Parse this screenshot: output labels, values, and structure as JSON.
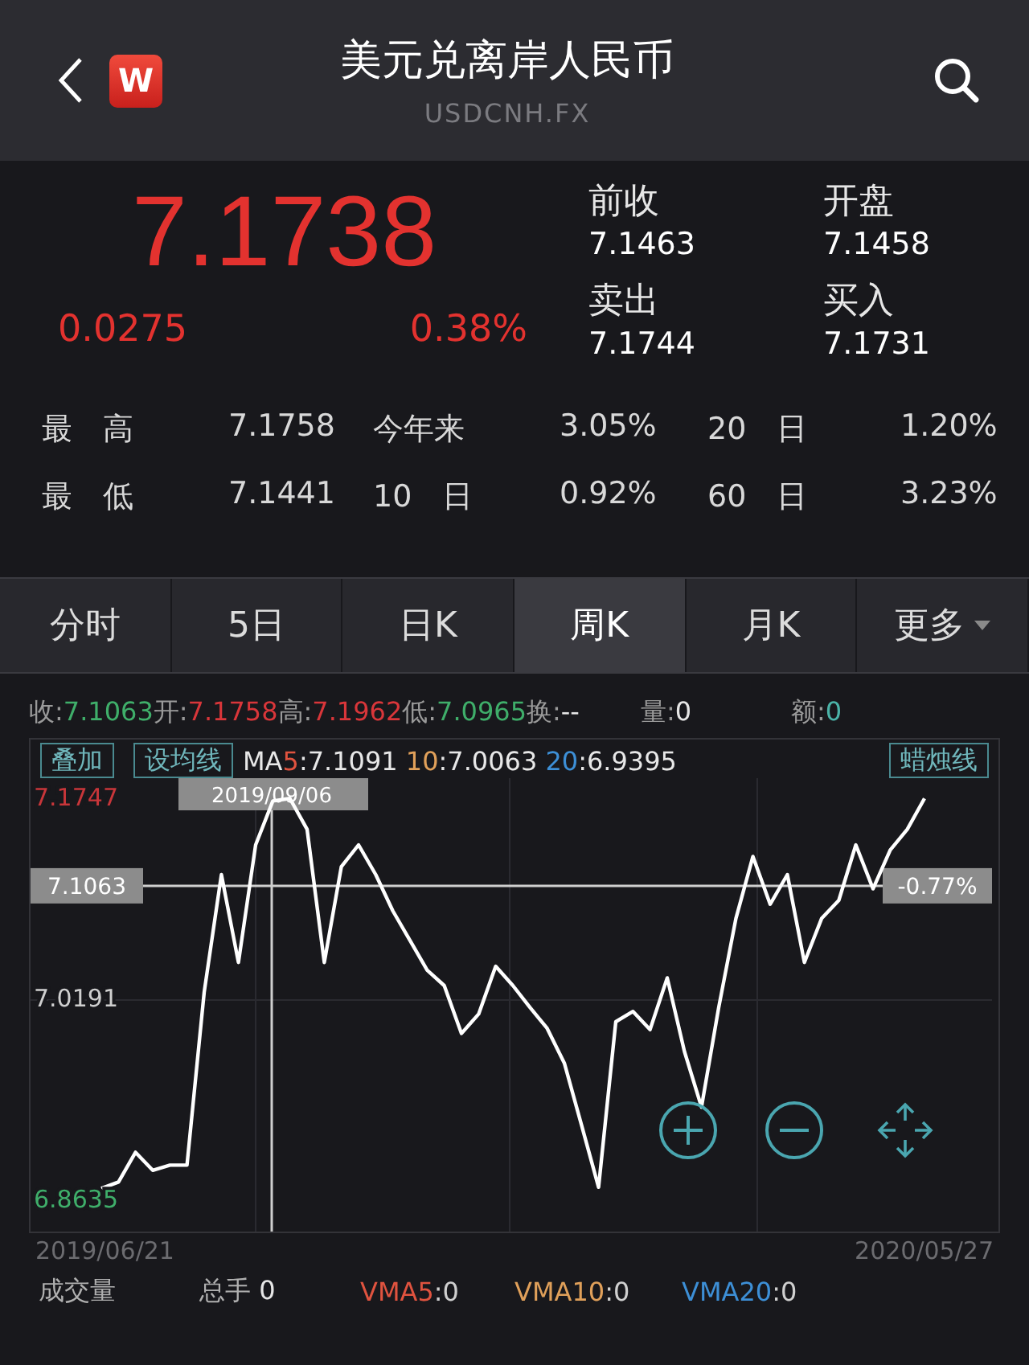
{
  "header": {
    "title": "美元兑离岸人民币",
    "subtitle": "USDCNH.FX",
    "logo": "W"
  },
  "quote": {
    "price": "7.1738",
    "change": "0.0275",
    "change_pct": "0.38%",
    "fields": [
      {
        "label": "前收",
        "value": "7.1463"
      },
      {
        "label": "开盘",
        "value": "7.1458"
      },
      {
        "label": "卖出",
        "value": "7.1744"
      },
      {
        "label": "买入",
        "value": "7.1731"
      }
    ]
  },
  "stats": [
    [
      {
        "label": "最　高",
        "value": "7.1758"
      },
      {
        "label": "今年来",
        "value": "3.05%"
      },
      {
        "label": "20　日",
        "value": "1.20%"
      }
    ],
    [
      {
        "label": "最　低",
        "value": "7.1441"
      },
      {
        "label": "10　日",
        "value": "0.92%"
      },
      {
        "label": "60　日",
        "value": "3.23%"
      }
    ]
  ],
  "tabs": [
    {
      "label": "分时",
      "selected": false
    },
    {
      "label": "5日",
      "selected": false
    },
    {
      "label": "日K",
      "selected": false
    },
    {
      "label": "周K",
      "selected": true
    },
    {
      "label": "月K",
      "selected": false
    },
    {
      "label": "更多",
      "selected": false,
      "dropdown": true
    }
  ],
  "info": [
    {
      "label": "收:",
      "value": "7.1063",
      "color": "#3fae6a"
    },
    {
      "label": "开:",
      "value": "7.1758",
      "color": "#d9363a"
    },
    {
      "label": "高:",
      "value": "7.1962",
      "color": "#d9363a"
    },
    {
      "label": "低:",
      "value": "7.0965",
      "color": "#3fae6a"
    },
    {
      "label": "换:",
      "value": "--",
      "color": "#e6e6e6"
    },
    {
      "label": "量:",
      "value": "0",
      "color": "#e6e6e6"
    },
    {
      "label": "额:",
      "value": "0",
      "color": "#4bb3a8"
    }
  ],
  "chart_tools": {
    "overlay": "叠加",
    "ma_setting": "设均线",
    "style": "蜡烛线",
    "ma_prefix": "MA",
    "ma": [
      {
        "period": "5",
        "value": ":7.1091",
        "color": "#e0533f"
      },
      {
        "period": "10",
        "value": ":7.0063",
        "color": "#e0a05a"
      },
      {
        "period": "20",
        "value": ":6.9395",
        "color": "#3d8fd6"
      }
    ]
  },
  "chart": {
    "chart_data": {
      "type": "line",
      "ylim": [
        6.8635,
        7.1747
      ],
      "yticks": [
        7.1747,
        7.0191,
        6.8635
      ],
      "grid": true,
      "ref_lines": [
        {
          "axis": "y",
          "value": 7.1063,
          "label": "7.1063"
        }
      ],
      "series": [
        {
          "color": "#ffffff",
          "values": [
            6.872,
            6.877,
            6.9,
            6.886,
            6.89,
            6.89,
            7.024,
            7.115,
            7.047,
            7.138,
            7.172,
            7.174,
            7.15,
            7.047,
            7.121,
            7.138,
            7.115,
            7.087,
            7.064,
            7.041,
            7.029,
            6.992,
            7.007,
            7.044,
            7.029,
            7.012,
            6.996,
            6.969,
            6.921,
            6.873,
            7.001,
            7.009,
            6.995,
            7.035,
            6.978,
            6.935,
            7.012,
            7.081,
            7.129,
            7.092,
            7.115,
            7.047,
            7.081,
            7.095,
            7.138,
            7.104,
            7.134,
            7.15,
            7.174
          ]
        }
      ]
    },
    "crosshair": {
      "date": "2019/09/06",
      "change": "-0.77%"
    },
    "date_range": {
      "start": "2019/06/21",
      "end": "2020/05/27"
    }
  },
  "volume": {
    "title": "成交量",
    "total_label": "总手",
    "total_value": "0",
    "vma": [
      {
        "name": "VMA5",
        "value": ":0",
        "color": "#e0533f"
      },
      {
        "name": "VMA10",
        "value": ":0",
        "color": "#e0a05a"
      },
      {
        "name": "VMA20",
        "value": ":0",
        "color": "#3d8fd6"
      }
    ]
  }
}
